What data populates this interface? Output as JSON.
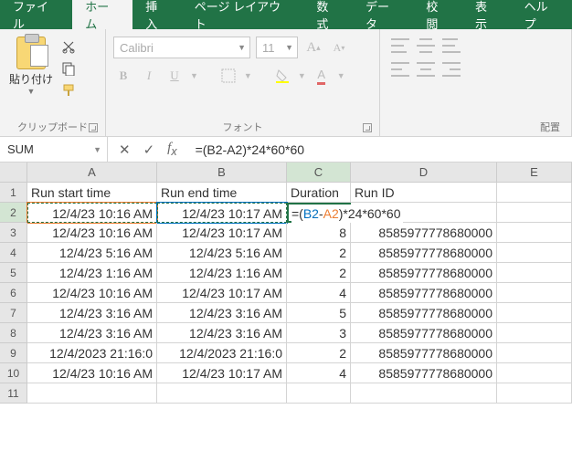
{
  "tabs": {
    "file": "ファイル",
    "home": "ホーム",
    "insert": "挿入",
    "layout": "ページ レイアウト",
    "formulas": "数式",
    "data": "データ",
    "review": "校閲",
    "view": "表示",
    "help": "ヘルプ"
  },
  "ribbon": {
    "clipboard_label": "クリップボード",
    "paste_label": "貼り付け",
    "font_label": "フォント",
    "font_name": "Calibri",
    "font_size": "11",
    "align_label": "配置"
  },
  "formula_bar": {
    "name_box": "SUM",
    "formula": "=(B2-A2)*24*60*60"
  },
  "columns": [
    "A",
    "B",
    "C",
    "D",
    "E"
  ],
  "headers": {
    "A": "Run start time",
    "B": "Run end time",
    "C": "Duration",
    "D": "Run ID"
  },
  "editing_row": {
    "A": "12/4/23 10:16 AM",
    "B": "12/4/23 10:17 AM",
    "C_prefix": "=(",
    "C_ref1": "B2",
    "C_mid": "-",
    "C_ref2": "A2",
    "C_suffix": ")*24*60*60"
  },
  "rows": [
    {
      "n": "3",
      "A": "12/4/23 10:16 AM",
      "B": "12/4/23 10:17 AM",
      "C": "8",
      "D": "8585977778680000"
    },
    {
      "n": "4",
      "A": "12/4/23 5:16 AM",
      "B": "12/4/23 5:16 AM",
      "C": "2",
      "D": "8585977778680000"
    },
    {
      "n": "5",
      "A": "12/4/23 1:16 AM",
      "B": "12/4/23 1:16 AM",
      "C": "2",
      "D": "8585977778680000"
    },
    {
      "n": "6",
      "A": "12/4/23 10:16 AM",
      "B": "12/4/23 10:17 AM",
      "C": "4",
      "D": "8585977778680000"
    },
    {
      "n": "7",
      "A": "12/4/23 3:16 AM",
      "B": "12/4/23 3:16 AM",
      "C": "5",
      "D": "8585977778680000"
    },
    {
      "n": "8",
      "A": "12/4/23 3:16 AM",
      "B": "12/4/23 3:16 AM",
      "C": "3",
      "D": "8585977778680000"
    },
    {
      "n": "9",
      "A": "12/4/2023  21:16:0",
      "B": "12/4/2023  21:16:0",
      "C": "2",
      "D": "8585977778680000"
    },
    {
      "n": "10",
      "A": "12/4/23 10:16 AM",
      "B": "12/4/23 10:17 AM",
      "C": "4",
      "D": "8585977778680000"
    }
  ],
  "row_header_1": "1",
  "row_header_2": "2",
  "row_header_11": "11"
}
